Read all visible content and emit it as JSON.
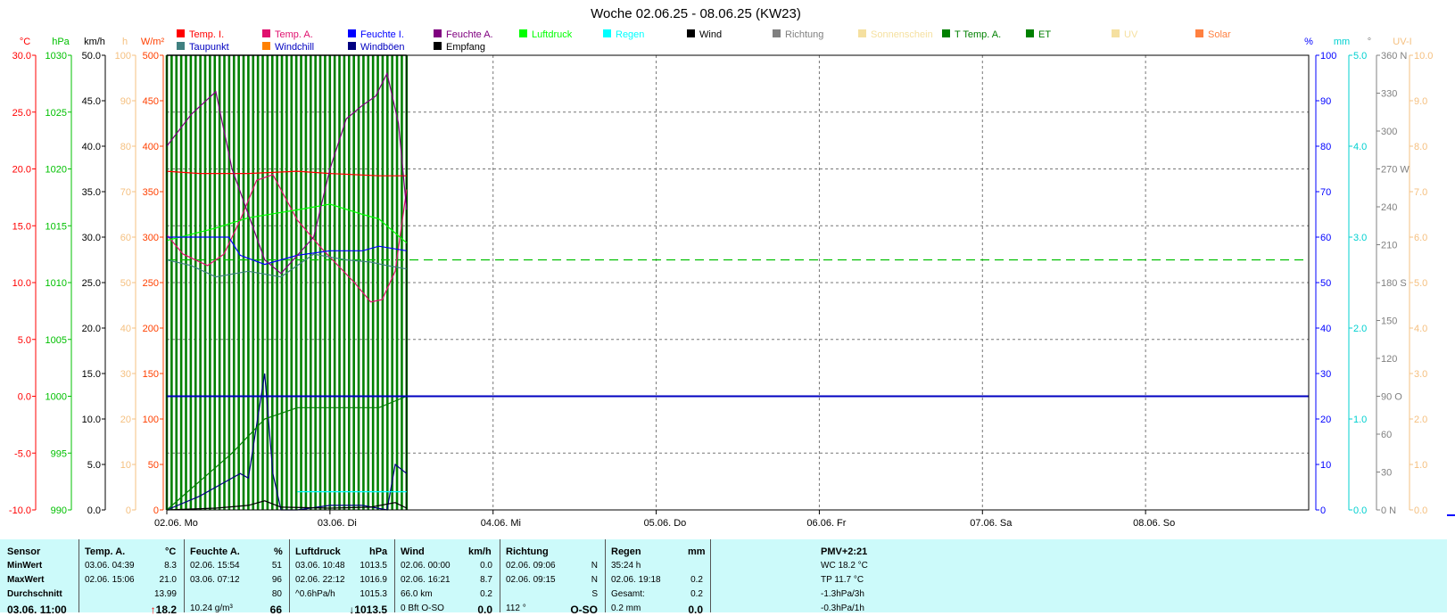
{
  "title": "Woche 02.06.25 - 08.06.25 (KW23)",
  "colors": {
    "temp_in": "#ff0000",
    "temp_out": "#e0106e",
    "hum_in": "#0000ff",
    "hum_out": "#800080",
    "pressure": "#00ff00",
    "rain": "#00ffff",
    "wind": "#000000",
    "direction": "#808080",
    "sunshine": "#f5e0a0",
    "t_temp_a": "#008000",
    "et": "#008000",
    "uv": "#f5e0a0",
    "solar": "#ff8040",
    "dewpoint": "#408080",
    "windchill": "#ff8000",
    "gust": "#000080",
    "reception": "#000000",
    "summary_bg": "#ccfafa"
  },
  "legend": {
    "row1": [
      {
        "label": "Temp. I.",
        "color": "#ff0000"
      },
      {
        "label": "Temp. A.",
        "color": "#e0106e"
      },
      {
        "label": "Feuchte I.",
        "color": "#0000ff"
      },
      {
        "label": "Feuchte A.",
        "color": "#800080"
      },
      {
        "label": "Luftdruck",
        "color": "#00ff00"
      },
      {
        "label": "Regen",
        "color": "#00ffff"
      },
      {
        "label": "Wind",
        "color": "#000000"
      },
      {
        "label": "Richtung",
        "color": "#808080"
      },
      {
        "label": "Sonnenschein",
        "color": "#f5e0a0"
      },
      {
        "label": "T Temp. A.",
        "color": "#008000"
      },
      {
        "label": "ET",
        "color": "#008000"
      },
      {
        "label": "UV",
        "color": "#f5e0a0"
      },
      {
        "label": "Solar",
        "color": "#ff8040"
      }
    ],
    "row2": [
      {
        "label": "Taupunkt",
        "color": "#408080"
      },
      {
        "label": "Windchill",
        "color": "#ff8000"
      },
      {
        "label": "Windböen",
        "color": "#000080"
      },
      {
        "label": "Empfang",
        "color": "#000000"
      }
    ]
  },
  "chart_data": {
    "type": "line",
    "title": "Woche 02.06.25 - 08.06.25 (KW23)",
    "x_ticks": [
      "02.06.  Mo",
      "03.06.  Di",
      "04.06.  Mi",
      "05.06.  Do",
      "06.06.  Fr",
      "07.06.  Sa",
      "08.06.  So"
    ],
    "x_range_days": [
      0,
      7
    ],
    "grid": true,
    "left_axes": [
      {
        "unit": "°C",
        "color": "#ff0000",
        "ticks": [
          "30.0",
          "25.0",
          "20.0",
          "15.0",
          "10.0",
          "5.0",
          "0.0",
          "-5.0",
          "-10.0"
        ]
      },
      {
        "unit": "hPa",
        "color": "#00c000",
        "ticks": [
          "1030",
          "1025",
          "1020",
          "1015",
          "1010",
          "1005",
          "1000",
          "995",
          "990"
        ]
      },
      {
        "unit": "km/h",
        "color": "#000000",
        "ticks": [
          "50.0",
          "45.0",
          "40.0",
          "35.0",
          "30.0",
          "25.0",
          "20.0",
          "15.0",
          "10.0",
          "5.0",
          "0.0"
        ]
      },
      {
        "unit": "h",
        "color": "#f5c080",
        "ticks": [
          "100",
          "90",
          "80",
          "70",
          "60",
          "50",
          "40",
          "30",
          "20",
          "10",
          "0"
        ]
      },
      {
        "unit": "W/m²",
        "color": "#ff4000",
        "ticks": [
          "500",
          "450",
          "400",
          "350",
          "300",
          "250",
          "200",
          "150",
          "100",
          "50",
          "0"
        ]
      }
    ],
    "right_axes": [
      {
        "unit": "%",
        "color": "#0000ff",
        "ticks": [
          "100",
          "90",
          "80",
          "70",
          "60",
          "50",
          "40",
          "30",
          "20",
          "10",
          "0"
        ]
      },
      {
        "unit": "mm",
        "color": "#00d0d0",
        "ticks": [
          "5.0",
          "4.0",
          "3.0",
          "2.0",
          "1.0",
          "0.0"
        ]
      },
      {
        "unit": "°",
        "color": "#808080",
        "ticks": [
          "360 N",
          "330",
          "300",
          "270 W",
          "240",
          "210",
          "180 S",
          "150",
          "120",
          "90  O",
          "60",
          "30",
          "0   N"
        ]
      },
      {
        "unit": "UV-I",
        "color": "#f5c080",
        "ticks": [
          "10.0",
          "9.0",
          "8.0",
          "7.0",
          "6.0",
          "5.0",
          "4.0",
          "3.0",
          "2.0",
          "1.0",
          "0.0"
        ]
      }
    ],
    "series": [
      {
        "name": "Temp. I.",
        "axis": "°C",
        "x": [
          0,
          0.2,
          0.5,
          0.8,
          1.0,
          1.3,
          1.47
        ],
        "y": [
          19.8,
          19.6,
          19.6,
          19.8,
          19.6,
          19.4,
          19.4
        ]
      },
      {
        "name": "Temp. A.",
        "axis": "°C",
        "x": [
          0,
          0.1,
          0.25,
          0.35,
          0.45,
          0.55,
          0.65,
          0.8,
          0.95,
          1.05,
          1.15,
          1.25,
          1.32,
          1.4,
          1.47
        ],
        "y": [
          14.2,
          12.5,
          11.5,
          12.5,
          15.5,
          19.0,
          19.5,
          15.5,
          13.0,
          11.5,
          10.0,
          8.3,
          8.5,
          11.0,
          18.2
        ]
      },
      {
        "name": "Taupunkt",
        "axis": "°C",
        "x": [
          0,
          0.15,
          0.3,
          0.5,
          0.7,
          0.9,
          1.1,
          1.25,
          1.35,
          1.47
        ],
        "y": [
          12.0,
          11.5,
          10.5,
          11.0,
          10.5,
          12.5,
          12.0,
          11.8,
          11.5,
          11.2
        ]
      },
      {
        "name": "Luftdruck",
        "axis": "hPa",
        "x": [
          0,
          0.3,
          0.5,
          0.8,
          1.0,
          1.2,
          1.3,
          1.47
        ],
        "y": [
          1013.7,
          1014.8,
          1015.7,
          1016.4,
          1016.9,
          1016.0,
          1015.6,
          1013.5
        ]
      },
      {
        "name": "Feuchte I.",
        "axis": "%",
        "x": [
          0,
          0.2,
          0.38,
          0.45,
          0.6,
          0.8,
          1.0,
          1.2,
          1.3,
          1.47
        ],
        "y": [
          60,
          60,
          60,
          56,
          54,
          56,
          57,
          57,
          58,
          57
        ]
      },
      {
        "name": "Feuchte A.",
        "axis": "%",
        "x": [
          0,
          0.15,
          0.3,
          0.4,
          0.5,
          0.6,
          0.7,
          0.9,
          1.0,
          1.1,
          1.2,
          1.28,
          1.35,
          1.42,
          1.47
        ],
        "y": [
          80,
          87,
          92,
          75,
          65,
          55,
          52,
          60,
          75,
          86,
          89,
          91,
          96,
          85,
          66
        ]
      },
      {
        "name": "Windböen",
        "axis": "km/h",
        "x": [
          0,
          0.2,
          0.35,
          0.45,
          0.5,
          0.6,
          0.65,
          0.7,
          0.8,
          1.0,
          1.2,
          1.35,
          1.4,
          1.47
        ],
        "y": [
          0,
          1.5,
          3.0,
          4.0,
          3.5,
          15.0,
          4.0,
          0,
          0,
          0.5,
          0.5,
          0,
          5.0,
          4.0
        ]
      },
      {
        "name": "Wind",
        "axis": "km/h",
        "x": [
          0,
          0.3,
          0.5,
          0.6,
          0.7,
          1.0,
          1.25,
          1.4,
          1.47
        ],
        "y": [
          0,
          0.2,
          0.5,
          1.0,
          0.3,
          0.2,
          0.3,
          0.8,
          0.2
        ]
      },
      {
        "name": "T Temp. A.",
        "axis": "hPa",
        "x": [
          0,
          0.4,
          0.6,
          0.8,
          1.0,
          1.3,
          1.47
        ],
        "y": [
          990,
          995,
          998,
          999,
          999,
          999,
          1000
        ]
      },
      {
        "name": "Regen",
        "axis": "mm",
        "x": [
          0.8,
          1.47
        ],
        "y": [
          0.2,
          0.2
        ]
      },
      {
        "name": "Empfang",
        "axis": "%",
        "x": [
          0,
          7
        ],
        "y": [
          25,
          25
        ]
      }
    ],
    "pressure_trend": {
      "axis": "hPa",
      "value": 1012.0
    }
  },
  "summary": {
    "headers": {
      "sensor": "Sensor",
      "temp": "Temp. A.",
      "temp_unit": "°C",
      "hum": "Feuchte A.",
      "hum_unit": "%",
      "press": "Luftdruck",
      "press_unit": "hPa",
      "wind": "Wind",
      "wind_unit": "km/h",
      "dir": "Richtung",
      "rain": "Regen",
      "rain_unit": "mm",
      "pmv": "PMV+2:21"
    },
    "rows": [
      {
        "label": "MinWert",
        "temp_t": "03.06.  04:39",
        "temp_v": "8.3",
        "hum_t": "02.06.  15:54",
        "hum_v": "51",
        "press_t": "03.06.  10:48",
        "press_v": "1013.5",
        "wind_t": "02.06.  00:00",
        "wind_v": "0.0",
        "dir_t": "02.06.  09:06",
        "dir_v": "N",
        "rain_t": "35:24 h",
        "rain_v": "",
        "extra": "WC 18.2 °C"
      },
      {
        "label": "MaxWert",
        "temp_t": "02.06.  15:06",
        "temp_v": "21.0",
        "hum_t": "03.06.  07:12",
        "hum_v": "96",
        "press_t": "02.06.  22:12",
        "press_v": "1016.9",
        "wind_t": "02.06.  16:21",
        "wind_v": "8.7",
        "dir_t": "02.06.  09:15",
        "dir_v": "N",
        "rain_t": "02.06.  19:18",
        "rain_v": "0.2",
        "extra": "TP 11.7 °C"
      },
      {
        "label": "Durchschnitt",
        "temp_t": "",
        "temp_v": "13.99",
        "hum_t": "",
        "hum_v": "80",
        "press_t": "^0.6hPa/h",
        "press_v": "1015.3",
        "wind_t": "66.0 km",
        "wind_v": "0.2",
        "dir_t": "",
        "dir_v": "S",
        "rain_t": "Gesamt:",
        "rain_v": "0.2",
        "extra": "-1.3hPa/3h"
      },
      {
        "label": "03.06.  11:00",
        "temp_t": "",
        "temp_v": "↑18.2",
        "hum_t": "10.24 g/m³",
        "hum_v": "66",
        "press_t": "",
        "press_v": "↓1013.5",
        "wind_t": "0 Bft O-SO",
        "wind_v": "0.0",
        "dir_t": "112 °",
        "dir_v": "O-SO",
        "rain_t": "0.2 mm",
        "rain_v": "0.0",
        "extra": "-0.3hPa/1h"
      }
    ]
  }
}
